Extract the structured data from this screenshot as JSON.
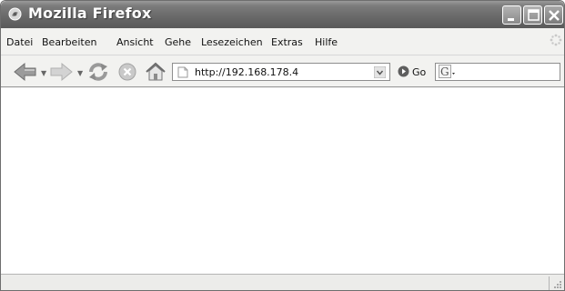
{
  "window": {
    "title": "Mozilla Firefox",
    "accent_color": "#6a6a6a"
  },
  "menu": {
    "items": [
      {
        "label": "Datei"
      },
      {
        "label": "Bearbeiten"
      },
      {
        "label": "Ansicht"
      },
      {
        "label": "Gehe"
      },
      {
        "label": "Lesezeichen"
      },
      {
        "label": "Extras"
      },
      {
        "label": "Hilfe"
      }
    ]
  },
  "toolbar": {
    "back_icon": "back-arrow-icon",
    "forward_icon": "forward-arrow-icon",
    "reload_icon": "reload-icon",
    "stop_icon": "stop-icon",
    "home_icon": "home-icon",
    "go_label": "Go"
  },
  "address": {
    "url": "http://192.168.178.4"
  },
  "search": {
    "value": "",
    "engine_icon": "google-icon"
  },
  "status": {
    "text": ""
  }
}
